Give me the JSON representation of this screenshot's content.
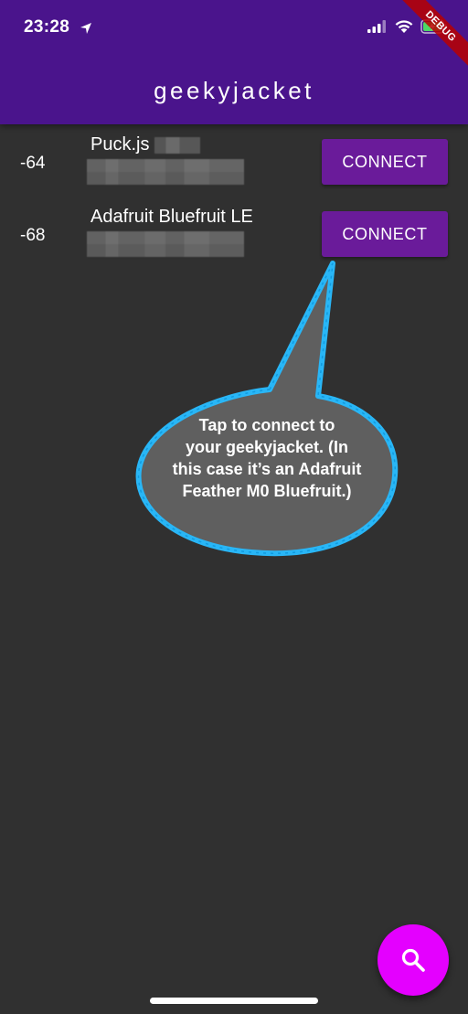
{
  "status_bar": {
    "time": "23:28"
  },
  "debug_banner": {
    "label": "DEBUG"
  },
  "app_bar": {
    "title": "geekyjacket"
  },
  "devices": [
    {
      "rssi": "-64",
      "name": "Puck.js",
      "connect_label": "CONNECT"
    },
    {
      "rssi": "-68",
      "name": "Adafruit Bluefruit LE",
      "connect_label": "CONNECT"
    }
  ],
  "callout": {
    "lines": [
      "Tap to connect to",
      "your geekyjacket. (In",
      "this case it’s an Adafruit",
      "Feather M0 Bluefruit.)"
    ]
  },
  "icons": {
    "location": "location-arrow-icon",
    "signal": "cellular-signal-icon",
    "wifi": "wifi-icon",
    "battery": "battery-charging-icon",
    "fab": "search-icon"
  },
  "colors": {
    "app_bar": "#4a148c",
    "background": "#303030",
    "connect_button": "#6a1b9a",
    "fab": "#e400ff",
    "callout_outline": "#29b6f6",
    "callout_fill": "#5f5f5f"
  }
}
